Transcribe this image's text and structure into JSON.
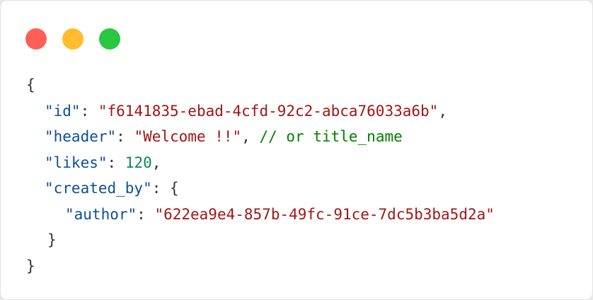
{
  "colors": {
    "close": "#ff5f57",
    "minimize": "#febc2e",
    "zoom": "#28c840",
    "key": "#0b4f99",
    "string": "#a31515",
    "number": "#098658",
    "comment": "#008000",
    "punctuation": "#333333"
  },
  "window_controls": [
    {
      "name": "close",
      "icon": "red-dot"
    },
    {
      "name": "minimize",
      "icon": "yellow-dot"
    },
    {
      "name": "zoom",
      "icon": "green-dot"
    }
  ],
  "code": {
    "open_brace": "{",
    "close_brace": "}",
    "fields": {
      "id": {
        "key": "\"id\"",
        "value": "\"f6141835-ebad-4cfd-92c2-abca76033a6b\""
      },
      "header": {
        "key": "\"header\"",
        "value": "\"Welcome !!\"",
        "comment": "// or title_name"
      },
      "likes": {
        "key": "\"likes\"",
        "value": "120"
      },
      "created_by": {
        "key": "\"created_by\"",
        "open_brace": "{",
        "close_brace": "}",
        "author": {
          "key": "\"author\"",
          "value": "\"622ea9e4-857b-49fc-91ce-7dc5b3ba5d2a\""
        }
      }
    },
    "punct": {
      "colon": ": ",
      "comma": ",",
      "comma_space": ", "
    }
  }
}
